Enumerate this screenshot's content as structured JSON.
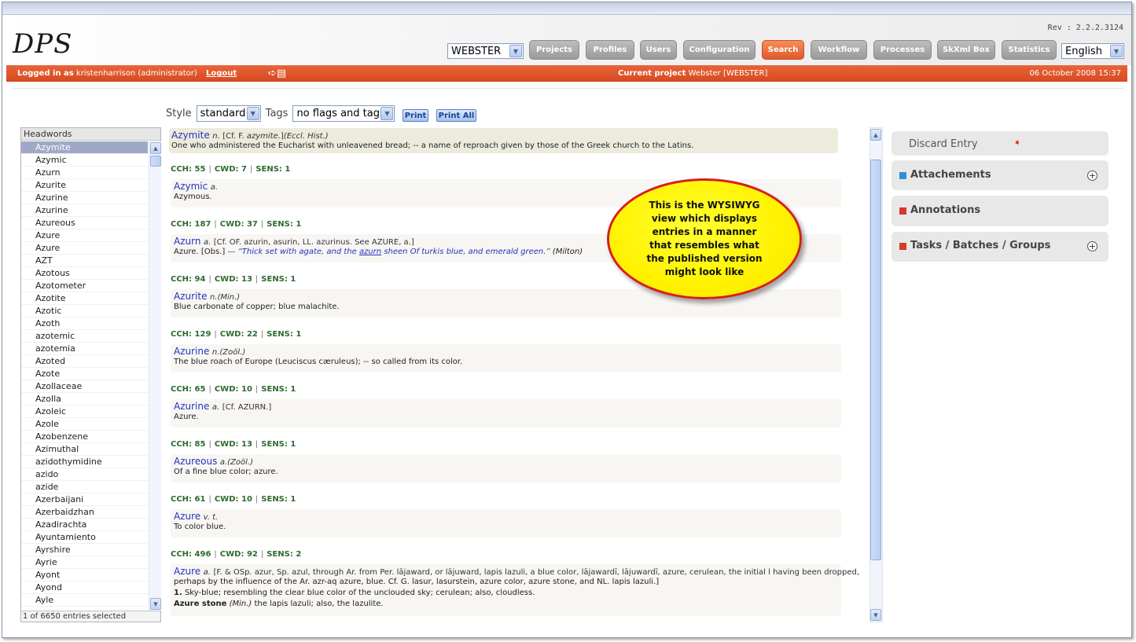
{
  "header": {
    "logo": "DPS",
    "revision": "Rev : 2.2.2.3124",
    "dictionary_select": "WEBSTER",
    "language_select": "English",
    "nav": [
      "Projects",
      "Profiles",
      "Users",
      "Configuration",
      "Search",
      "Workflow",
      "Processes",
      "SkXml Box",
      "Statistics"
    ],
    "active_nav": "Search"
  },
  "status_bar": {
    "logged_in_label": "Logged in as",
    "user": "kristenharrison (administrator)",
    "logout": "Logout",
    "current_project_label": "Current project",
    "current_project": "Webster [WEBSTER]",
    "datetime": "06 October 2008 15:37"
  },
  "toolbar": {
    "style_label": "Style",
    "style_value": "standard",
    "tags_label": "Tags",
    "tags_value": "no flags and tags",
    "print": "Print",
    "print_all": "Print All"
  },
  "headwords": {
    "title": "Headwords",
    "items": [
      "Azymite",
      "Azymic",
      "Azurn",
      "Azurite",
      "Azurine",
      "Azurine",
      "Azureous",
      "Azure",
      "Azure",
      "AZT",
      "Azotous",
      "Azotometer",
      "Azotite",
      "Azotic",
      "Azoth",
      "azotemic",
      "azotemia",
      "Azoted",
      "Azote",
      "Azollaceae",
      "Azolla",
      "Azoleic",
      "Azole",
      "Azobenzene",
      "Azimuthal",
      "azidothymidine",
      "azido",
      "azide",
      "Azerbaijani",
      "Azerbaidzhan",
      "Azadirachta",
      "Ayuntamiento",
      "Ayrshire",
      "Ayrie",
      "Ayont",
      "Ayond",
      "Ayle"
    ],
    "selected_index": 0,
    "footer": "1 of 6650 entries selected"
  },
  "entries": {
    "first": {
      "headword": "Azymite",
      "pos": "n.",
      "etym_prefix": "[Cf. F.",
      "etym_word": "azymite.",
      "etym_suffix": "]",
      "label": "(Eccl. Hist.)",
      "def": "One who administered the Eucharist with unleavened bread; -- a name of reproach given by those of the Greek church to the Latins."
    },
    "sections": [
      {
        "cch": "55",
        "cwd": "7",
        "sens": "1",
        "headword": "Azymic",
        "pos": "a.",
        "etym": "",
        "def": "Azymous."
      },
      {
        "cch": "187",
        "cwd": "37",
        "sens": "1",
        "headword": "Azurn",
        "pos": "a.",
        "etym": "[Cf. OF. azurin, asurin, LL. azurinus. See AZURE, a.]",
        "def": "Azure. [Obs.]",
        "quote_prefix": "— “Thick set with agate, and the ",
        "quote_link": "azurn",
        "quote_suffix": " sheen Of turkis blue, and emerald green.”",
        "source": "(Milton)"
      },
      {
        "cch": "94",
        "cwd": "13",
        "sens": "1",
        "headword": "Azurite",
        "pos": "n.(Min.)",
        "etym": "",
        "def": "Blue carbonate of copper; blue malachite."
      },
      {
        "cch": "129",
        "cwd": "22",
        "sens": "1",
        "headword": "Azurine",
        "pos": "n.(Zoöl.)",
        "etym": "",
        "def": "The blue roach of Europe (Leuciscus cæruleus); -- so called from its color."
      },
      {
        "cch": "65",
        "cwd": "10",
        "sens": "1",
        "headword": "Azurine",
        "pos": "a.",
        "etym": "[Cf. AZURN.]",
        "def": "Azure."
      },
      {
        "cch": "85",
        "cwd": "13",
        "sens": "1",
        "headword": "Azureous",
        "pos": "a.(Zoöl.)",
        "etym": "",
        "def": "Of a fine blue color; azure."
      },
      {
        "cch": "61",
        "cwd": "10",
        "sens": "1",
        "headword": "Azure",
        "pos": "v. t.",
        "etym": "",
        "def": "To color blue."
      },
      {
        "cch": "496",
        "cwd": "92",
        "sens": "2",
        "headword": "Azure",
        "pos": "a.",
        "etym": "[F. & OSp. azur, Sp. azul, through Ar. from Per. lājaward, or lājuward, lapis lazuli, a blue color, lājawardī, lājuwardī, azure, cerulean, the initial l having been dropped,",
        "etym2": "perhaps by the influence of the Ar. azr-aq azure, blue. Cf. G. lasur, lasurstein, azure color, azure stone, and NL. lapis lazuli.]",
        "sense_num": "1.",
        "def": "Sky-blue; resembling the clear blue color of the unclouded sky; cerulean; also, cloudless.",
        "sub_term": "Azure stone",
        "sub_label": "(Min.)",
        "sub_def": "the lapis lazuli; also, the lazulite."
      }
    ],
    "labels": {
      "cch": "CCH:",
      "cwd": "CWD:",
      "sens": "SENS:",
      "sep": "|"
    }
  },
  "side": {
    "discard": "Discard Entry",
    "attachments": "Attachements",
    "annotations": "Annotations",
    "tasks": "Tasks / Batches / Groups"
  },
  "callout": "This is the WYSIWYG view which displays entries in a manner that resembles what the published version might look like"
}
